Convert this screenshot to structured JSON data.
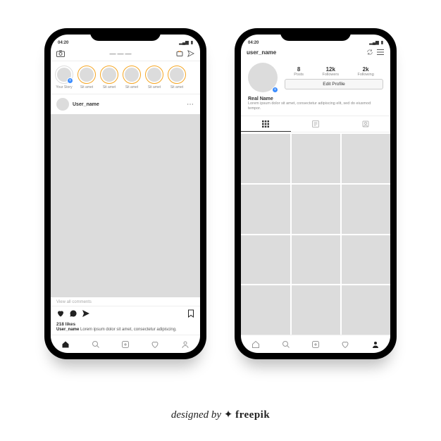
{
  "status": {
    "time": "04:20"
  },
  "feed": {
    "stories": [
      {
        "label": "Your Story",
        "self": true
      },
      {
        "label": "Sit amet"
      },
      {
        "label": "Sit amet"
      },
      {
        "label": "Sit amet"
      },
      {
        "label": "Sit amet"
      },
      {
        "label": "Sit amet"
      }
    ],
    "post": {
      "user": "User_name",
      "likes": "218 likes",
      "caption_user": "User_name",
      "caption_text": "Lorem ipsum dolor sit amet, consectetur adipiscing.",
      "view_all": "View all comments"
    }
  },
  "profile": {
    "username": "user_name",
    "stats": [
      {
        "n": "8",
        "t": "Posts"
      },
      {
        "n": "12k",
        "t": "Followers"
      },
      {
        "n": "2k",
        "t": "Following"
      }
    ],
    "edit_label": "Edit Profile",
    "real_name": "Real Name",
    "bio": "Lorem ipsum dolor sit amet, consectetur adipiscing elit, sed do eiusmod tempor."
  },
  "credit": {
    "by": "designed by",
    "brand": "freepik"
  }
}
